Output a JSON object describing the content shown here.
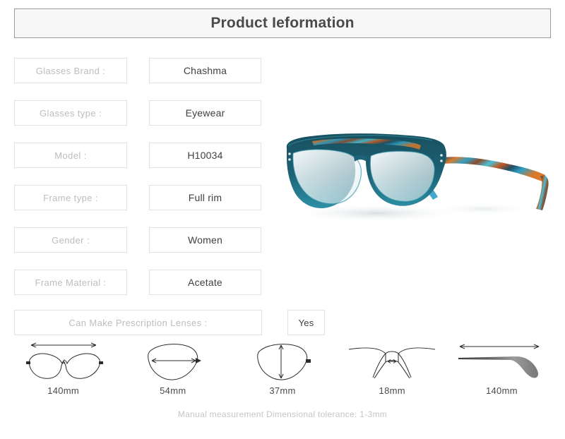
{
  "header": {
    "title": "Product Ieformation",
    "background": "#f7f7f7",
    "border_color": "#9a9a9a",
    "text_color": "#4a4a4a"
  },
  "specs": [
    {
      "label": "Glasses Brand :",
      "value": "Chashma"
    },
    {
      "label": "Glasses type :",
      "value": "Eyewear"
    },
    {
      "label": "Model :",
      "value": "H10034"
    },
    {
      "label": "Frame type :",
      "value": "Full rim"
    },
    {
      "label": "Gender :",
      "value": "Women"
    },
    {
      "label": "Frame Material :",
      "value": "Acetate"
    },
    {
      "label": "Can Make Prescription Lenses :",
      "value": "Yes"
    }
  ],
  "product_image": {
    "alt": "teal acetate full rim eyeglasses with multicolor patterned temples",
    "frame_color": "#1b5a6b",
    "frame_color_light": "#2c7e92",
    "pattern_colors": [
      "#d9792c",
      "#2f9fc4",
      "#1f4f63",
      "#8e4c2a",
      "#45c3d8",
      "#c4571f"
    ]
  },
  "measurements": [
    {
      "name": "frame-width",
      "caption": "140mm"
    },
    {
      "name": "lens-width",
      "caption": "54mm"
    },
    {
      "name": "lens-height",
      "caption": "37mm"
    },
    {
      "name": "bridge-width",
      "caption": "18mm"
    },
    {
      "name": "temple-length",
      "caption": "140mm"
    }
  ],
  "footer": {
    "note": "Manual measurement Dimensional tolerance: 1-3mm",
    "text_color": "#c6c6c6"
  }
}
